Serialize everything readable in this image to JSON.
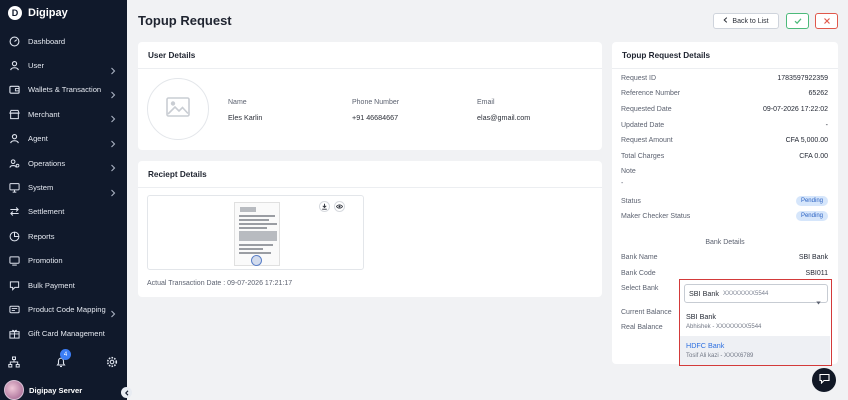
{
  "brand": {
    "name": "Digipay",
    "logo_letter": "D"
  },
  "sidebar": {
    "items": [
      {
        "label": "Dashboard",
        "icon": "dashboard-icon",
        "has_children": false
      },
      {
        "label": "User",
        "icon": "user-icon",
        "has_children": true
      },
      {
        "label": "Wallets & Transaction",
        "icon": "wallet-icon",
        "has_children": true
      },
      {
        "label": "Merchant",
        "icon": "store-icon",
        "has_children": true
      },
      {
        "label": "Agent",
        "icon": "agent-icon",
        "has_children": true
      },
      {
        "label": "Operations",
        "icon": "users-cog-icon",
        "has_children": true
      },
      {
        "label": "System",
        "icon": "monitor-icon",
        "has_children": true
      },
      {
        "label": "Settlement",
        "icon": "swap-icon",
        "has_children": false
      },
      {
        "label": "Reports",
        "icon": "report-icon",
        "has_children": false
      },
      {
        "label": "Promotion",
        "icon": "promotion-icon",
        "has_children": false
      },
      {
        "label": "Bulk Payment",
        "icon": "bulk-payment-icon",
        "has_children": false
      },
      {
        "label": "Product Code Mapping",
        "icon": "product-code-icon",
        "has_children": true
      },
      {
        "label": "Gift Card Management",
        "icon": "gift-card-icon",
        "has_children": false
      }
    ],
    "notification_count": "4",
    "user_name": "Digipay Server"
  },
  "header": {
    "title": "Topup Request",
    "back_label": "Back to List"
  },
  "user_details": {
    "title": "User Details",
    "name_label": "Name",
    "name_value": "Eles Karlin",
    "phone_label": "Phone Number",
    "phone_value": "+91 46684667",
    "email_label": "Email",
    "email_value": "elas@gmail.com"
  },
  "receipt": {
    "title": "Reciept Details",
    "transaction_date": "Actual Transaction Date : 09-07-2026 17:21:17"
  },
  "topup_details": {
    "title": "Topup Request Details",
    "rows": [
      {
        "label": "Request ID",
        "value": "1783597922359"
      },
      {
        "label": "Reference Number",
        "value": "65262"
      },
      {
        "label": "Requested Date",
        "value": "09-07-2026 17:22:02"
      },
      {
        "label": "Updated Date",
        "value": "-"
      },
      {
        "label": "Request Amount",
        "value": "CFA 5,000.00"
      },
      {
        "label": "Total Charges",
        "value": "CFA 0.00"
      }
    ],
    "note_label": "Note",
    "note_value": "-",
    "status_label": "Status",
    "status_value": "Pending",
    "maker_label": "Maker Checker Status",
    "maker_value": "Pending",
    "bank_section_title": "Bank Details",
    "bank_name_label": "Bank Name",
    "bank_name_value": "SBI Bank",
    "bank_code_label": "Bank Code",
    "bank_code_value": "SBI011",
    "select_bank_label": "Select Bank",
    "current_balance_label": "Current Balance",
    "real_balance_label": "Real Balance"
  },
  "bank_select": {
    "selected_name": "SBI Bank",
    "selected_account": "XXXXXXXX5544",
    "options": [
      {
        "name": "SBI Bank",
        "account": "Abhishek - XXXXXXXX5544"
      },
      {
        "name": "HDFC Bank",
        "account": "Tosif Ali kazi - XXXX6789"
      }
    ]
  },
  "colors": {
    "sidebar_bg": "#10192b",
    "accent": "#2c6fe0",
    "success": "#4cba7a",
    "danger": "#e0584b",
    "highlight_frame": "#d33a3a",
    "pill_bg": "#d6e6fb"
  }
}
